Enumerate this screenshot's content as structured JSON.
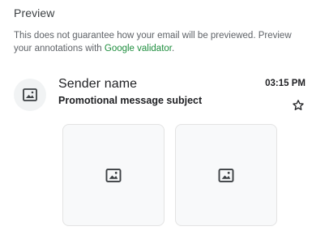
{
  "header": {
    "title": "Preview"
  },
  "disclaimer": {
    "text": "This does not guarantee how your email will be previewed. Preview your annotations with ",
    "link_label": "Google validator",
    "suffix": "."
  },
  "message": {
    "sender_name": "Sender name",
    "subject": "Promotional message subject",
    "time": "03:15 PM",
    "avatar_icon": "image-icon",
    "star_icon": "star-outline-icon"
  },
  "tiles": [
    {
      "icon": "image-icon"
    },
    {
      "icon": "image-icon"
    }
  ],
  "colors": {
    "link": "#1e8e3e",
    "text_primary": "#202124",
    "text_secondary": "#5f6368",
    "tile_border": "#e3e3e3",
    "avatar_bg": "#f1f3f4"
  }
}
